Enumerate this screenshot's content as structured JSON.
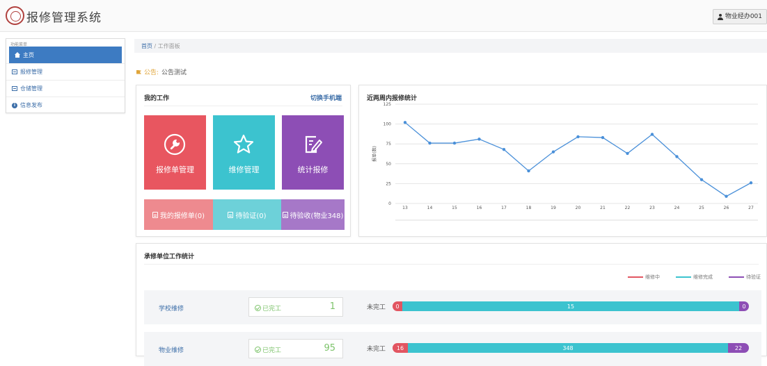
{
  "app": {
    "title": "报修管理系统",
    "user": "物业经办001"
  },
  "sidebar": {
    "heading": "功能菜单",
    "items": [
      {
        "label": "主页",
        "active": true,
        "icon": "home-icon"
      },
      {
        "label": "报修管理",
        "icon": "list-icon"
      },
      {
        "label": "仓储管理",
        "icon": "list-icon"
      },
      {
        "label": "信息发布",
        "icon": "info-icon"
      }
    ]
  },
  "breadcrumb": {
    "home": "首页",
    "sep": "/",
    "current": "工作面板"
  },
  "notice": {
    "label": "公告:",
    "text": "公告测试"
  },
  "work": {
    "title": "我的工作",
    "switch_label": "切换手机端",
    "tiles": [
      {
        "label": "报修单管理",
        "icon": "wrench-icon",
        "color": "#e85660"
      },
      {
        "label": "维修管理",
        "icon": "star-icon",
        "color": "#3cc3cf"
      },
      {
        "label": "统计报修",
        "icon": "edit-icon",
        "color": "#8d4eb5"
      }
    ],
    "subtiles": [
      {
        "label": "我的报修单(0)"
      },
      {
        "label": "待验证(0)"
      },
      {
        "label": "待验收(物业348)"
      }
    ]
  },
  "chart_data": {
    "type": "line",
    "title": "近两周内报修统计",
    "ylabel": "报单(数)",
    "x": [
      "13",
      "14",
      "15",
      "16",
      "17",
      "18",
      "19",
      "20",
      "21",
      "22",
      "23",
      "24",
      "25",
      "26",
      "27"
    ],
    "series": [
      {
        "values": [
          102,
          76,
          76,
          81,
          68,
          41,
          65,
          84,
          83,
          63,
          87,
          59,
          30,
          9,
          26
        ]
      }
    ],
    "ylim": [
      0,
      125
    ],
    "yticks": [
      0,
      25,
      50,
      75,
      100,
      125
    ],
    "grid": true,
    "color": "#4a90d9"
  },
  "units": {
    "title": "承修单位工作统计",
    "legend": [
      {
        "label": "维修中",
        "color": "#e25561"
      },
      {
        "label": "维修完成",
        "color": "#3cc3cf"
      },
      {
        "label": "待验证",
        "color": "#8d4eb5"
      }
    ],
    "done_label": "已完工",
    "undone_label": "未完工",
    "rows": [
      {
        "name": "学校维修",
        "done": "1",
        "in_progress": "0",
        "completed": "15",
        "pending": "0"
      },
      {
        "name": "物业维修",
        "done": "95",
        "in_progress": "16",
        "completed": "348",
        "pending": "22"
      }
    ]
  }
}
